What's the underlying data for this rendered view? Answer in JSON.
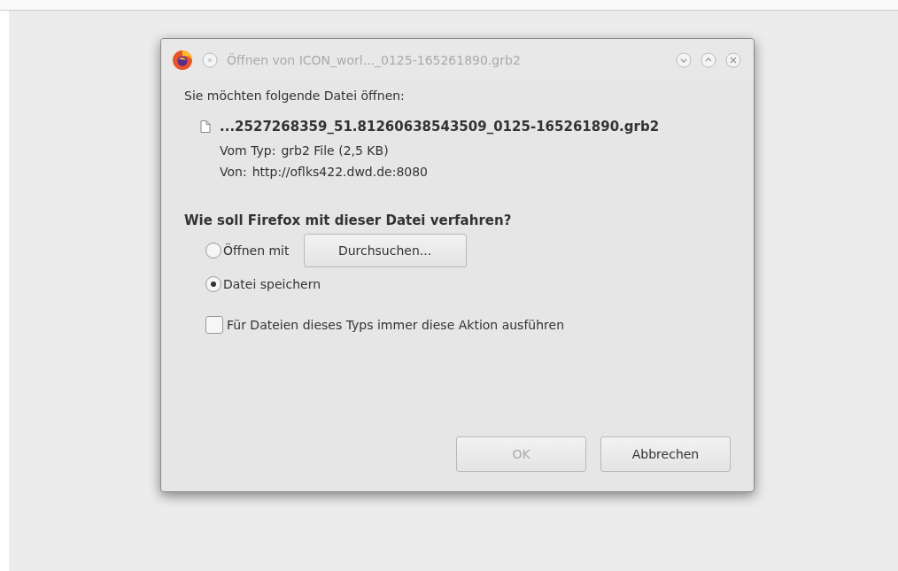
{
  "window": {
    "title": "Öffnen von ICON_worl..._0125-165261890.grb2"
  },
  "intro": "Sie möchten folgende Datei öffnen:",
  "file": {
    "name": "...2527268359_51.81260638543509_0125-165261890.grb2",
    "details": [
      {
        "label": "Vom Typ:",
        "value": "grb2 File (2,5 KB)"
      },
      {
        "label": "Von:",
        "value": "http://oflks422.dwd.de:8080"
      }
    ]
  },
  "question": "Wie soll Firefox mit dieser Datei verfahren?",
  "options": [
    {
      "label": "Öffnen mit",
      "selected": false,
      "button": "Durchsuchen..."
    },
    {
      "label": "Datei speichern",
      "selected": true
    }
  ],
  "remember": {
    "label": "Für Dateien dieses Typs immer diese Aktion ausführen",
    "checked": false
  },
  "buttons": [
    {
      "label": "OK",
      "disabled": true
    },
    {
      "label": "Abbrechen",
      "disabled": false
    }
  ]
}
